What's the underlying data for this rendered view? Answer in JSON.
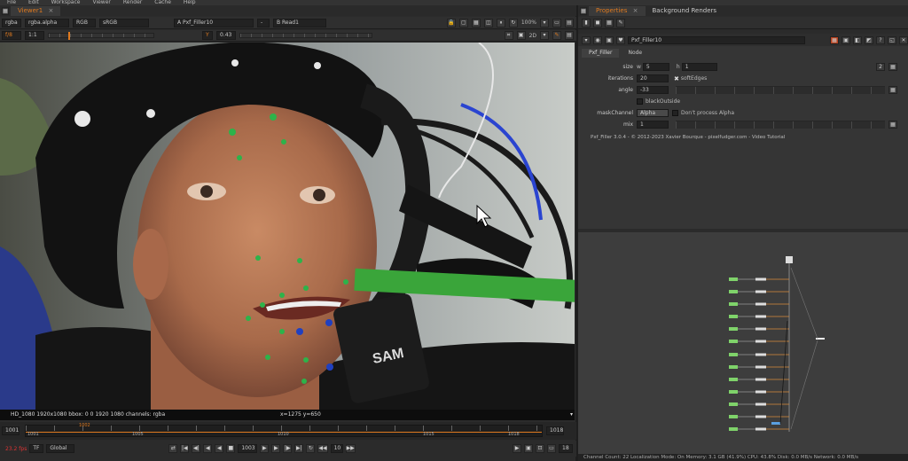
{
  "menu": [
    "File",
    "Edit",
    "Workspace",
    "Viewer",
    "Render",
    "Cache",
    "Help"
  ],
  "viewer": {
    "tab_label": "Viewer1",
    "channels": "rgba",
    "layer": "rgba.alpha",
    "display": "RGB",
    "colorspace": "sRGB",
    "input_a": "A  Pxf_Filler10",
    "input_b": "B  Read1",
    "zoom": "100%",
    "zoom_ratio": "1:1",
    "fstop_label": "f/8",
    "gain": "1",
    "gamma_label": "Y",
    "gamma": "0.43",
    "view_mode": "2D",
    "info_left": "HD_1080 1920x1080  bbox: 0 0 1920 1080 channels: rgba",
    "info_coords": "x=1275 y=650"
  },
  "timeline": {
    "start": "1001",
    "end": "1018",
    "ticks": [
      "1001",
      "1005",
      "1010",
      "1015",
      "1018"
    ],
    "current_marker": "1002",
    "fps_label": "TF",
    "scope": "Global",
    "current_frame": "1003",
    "step": "10",
    "end_frame": "18",
    "realtime": "23.2 fps"
  },
  "properties": {
    "tab_properties": "Properties",
    "tab_bg_renders": "Background Renders",
    "node_name": "Pxf_Filler10",
    "tab_node": "Pxf_Filler",
    "tab_node2": "Node",
    "size_label": "size",
    "size_w_label": "w",
    "size_w": "5",
    "size_h_label": "h",
    "size_h": "1",
    "size_count": "2",
    "iterations_label": "iterations",
    "iterations": "20",
    "softedges_label": "softEdges",
    "angle_label": "angle",
    "angle": "-33",
    "blackoutside_label": "blackOutside",
    "maskchannel_label": "maskChannel",
    "maskchannel": "Alpha",
    "dont_process_label": "Don't process Alpha",
    "mix_label": "mix",
    "mix": "1",
    "credits": "Pxf_Filler 3.0.4  -  © 2012-2023  Xavier Bourque  -  pixelfudger.com  -  Video Tutorial"
  },
  "status": "Channel Count: 22  Localization Mode: On  Memory: 3.1 GB (41.9%)  CPU: 43.8%  Disk: 0.0 MB/s  Network: 0.0 MB/s",
  "image_text": {
    "headset_label": "SAM"
  },
  "colors": {
    "accent": "#e07a1f",
    "tracking_green": "#2db34a",
    "tracking_blue": "#2040c0"
  }
}
